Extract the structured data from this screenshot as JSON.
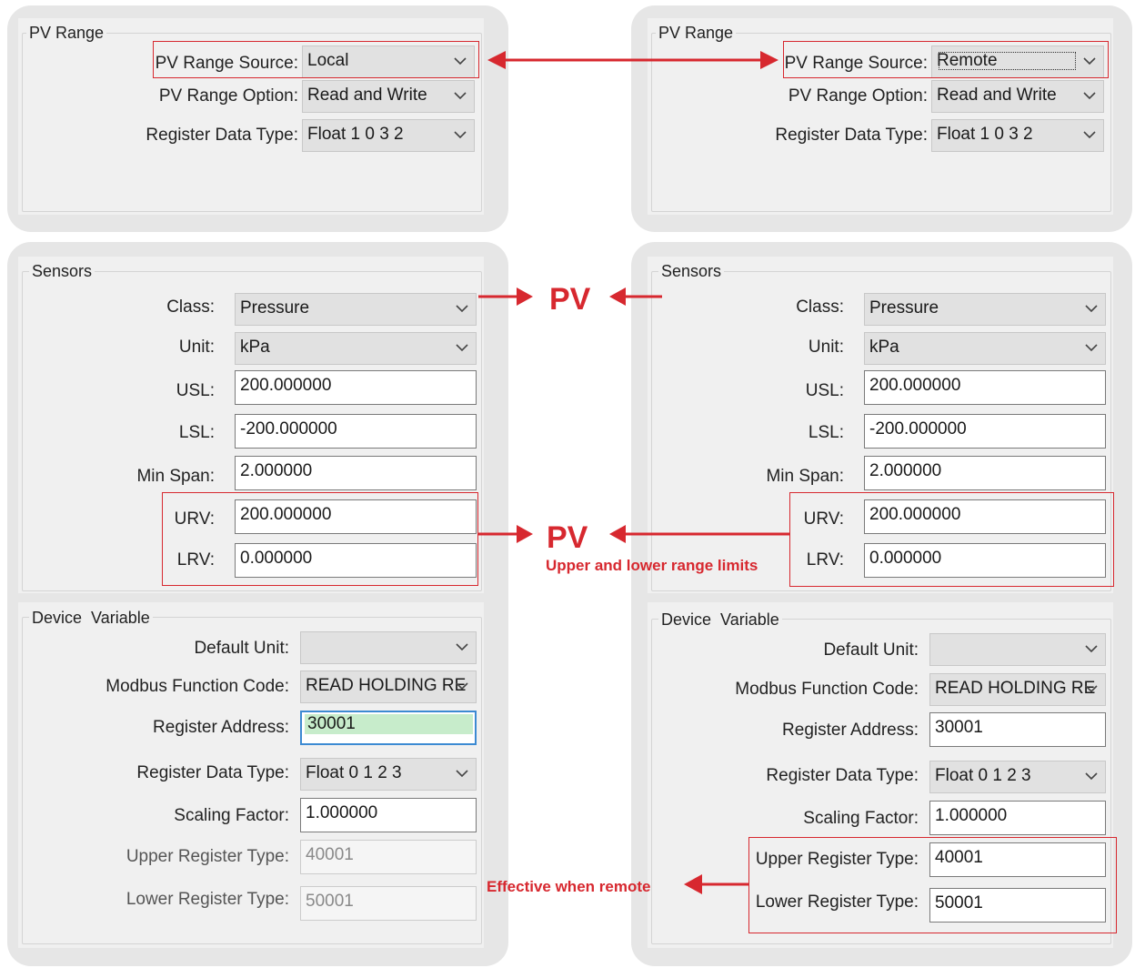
{
  "left": {
    "pv_range": {
      "title": "PV Range",
      "source_label": "PV Range Source:",
      "source_value": "Local",
      "option_label": "PV Range Option:",
      "option_value": "Read and Write",
      "dtype_label": "Register Data Type:",
      "dtype_value": "Float 1 0 3 2"
    },
    "sensors": {
      "title": "Sensors",
      "class_label": "Class:",
      "class_value": "Pressure",
      "unit_label": "Unit:",
      "unit_value": "kPa",
      "usl_label": "USL:",
      "usl_value": "200.000000",
      "lsl_label": "LSL:",
      "lsl_value": "-200.000000",
      "minspan_label": "Min Span:",
      "minspan_value": "2.000000",
      "urv_label": "URV:",
      "urv_value": "200.000000",
      "lrv_label": "LRV:",
      "lrv_value": "0.000000"
    },
    "device_variable": {
      "title": "Device  Variable",
      "default_unit_label": "Default Unit:",
      "default_unit_value": "",
      "modbus_label": "Modbus Function Code:",
      "modbus_value": "READ HOLDING RE",
      "reg_addr_label": "Register Address:",
      "reg_addr_value": "30001",
      "dtype_label": "Register Data Type:",
      "dtype_value": "Float 0 1 2 3",
      "scaling_label": "Scaling Factor:",
      "scaling_value": "1.000000",
      "upper_label": "Upper Register Type:",
      "upper_value": "40001",
      "lower_label": "Lower Register Type:",
      "lower_value": "50001"
    }
  },
  "right": {
    "pv_range": {
      "title": "PV Range",
      "source_label": "PV Range Source:",
      "source_value": "Remote",
      "option_label": "PV Range Option:",
      "option_value": "Read and Write",
      "dtype_label": "Register Data Type:",
      "dtype_value": "Float 1 0 3 2"
    },
    "sensors": {
      "title": "Sensors",
      "class_label": "Class:",
      "class_value": "Pressure",
      "unit_label": "Unit:",
      "unit_value": "kPa",
      "usl_label": "USL:",
      "usl_value": "200.000000",
      "lsl_label": "LSL:",
      "lsl_value": "-200.000000",
      "minspan_label": "Min Span:",
      "minspan_value": "2.000000",
      "urv_label": "URV:",
      "urv_value": "200.000000",
      "lrv_label": "LRV:",
      "lrv_value": "0.000000"
    },
    "device_variable": {
      "title": "Device  Variable",
      "default_unit_label": "Default Unit:",
      "default_unit_value": "",
      "modbus_label": "Modbus Function Code:",
      "modbus_value": "READ HOLDING RE",
      "reg_addr_label": "Register Address:",
      "reg_addr_value": "30001",
      "dtype_label": "Register Data Type:",
      "dtype_value": "Float 0 1 2 3",
      "scaling_label": "Scaling Factor:",
      "scaling_value": "1.000000",
      "upper_label": "Upper Register Type:",
      "upper_value": "40001",
      "lower_label": "Lower Register Type:",
      "lower_value": "50001"
    }
  },
  "annotations": {
    "pv_class": "PV",
    "pv_range": "PV",
    "range_limits": "Upper and lower range limits",
    "effective_remote": "Effective when remote"
  },
  "colors": {
    "accent_red": "#d7282f",
    "focus_blue": "#3c8ad2",
    "selection_green": "#c7eccb",
    "panel_bg": "#f0f0f0",
    "card_bg": "#e6e6e6"
  }
}
